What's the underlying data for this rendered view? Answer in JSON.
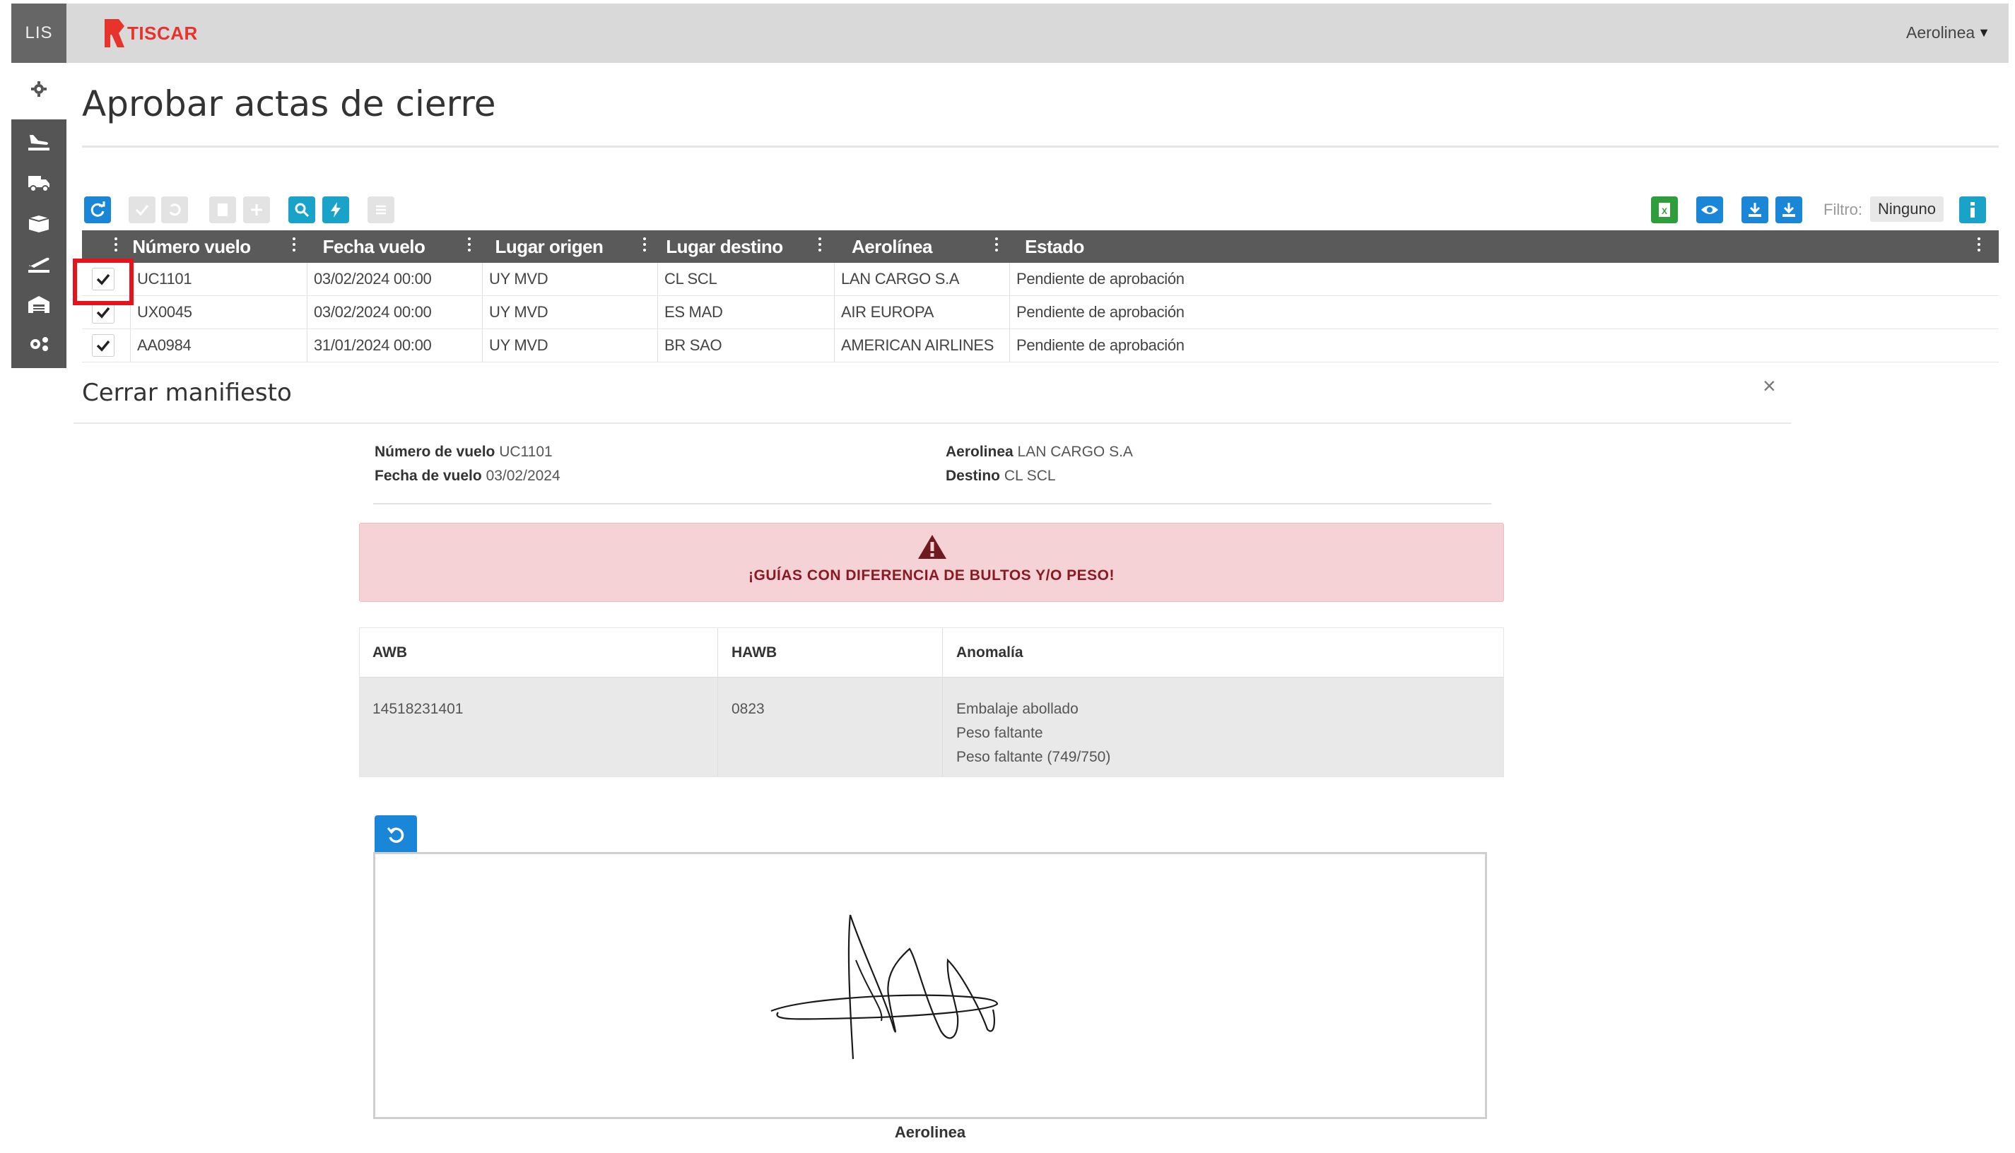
{
  "app": {
    "short_name": "LIS",
    "logo_text": "TISCAR",
    "user_menu": "Aerolinea",
    "brand_color": "#e8322c"
  },
  "sidebar": {
    "items": [
      {
        "icon": "gear-icon"
      },
      {
        "icon": "plane-landing-icon"
      },
      {
        "icon": "truck-icon"
      },
      {
        "icon": "box-icon"
      },
      {
        "icon": "plane-takeoff-icon"
      },
      {
        "icon": "warehouse-icon"
      },
      {
        "icon": "settings-icon"
      }
    ]
  },
  "page": {
    "title": "Aprobar actas de cierre"
  },
  "toolbar": {
    "filter_label": "Filtro:",
    "filter_value": "Ninguno"
  },
  "grid": {
    "columns": [
      "Número vuelo",
      "Fecha vuelo",
      "Lugar origen",
      "Lugar destino",
      "Aerolínea",
      "Estado"
    ],
    "rows": [
      {
        "checked": true,
        "numero": "UC1101",
        "fecha": "03/02/2024 00:00",
        "origen": "UY MVD",
        "destino": "CL SCL",
        "aerolinea": "LAN CARGO S.A",
        "estado": "Pendiente de aprobación"
      },
      {
        "checked": true,
        "numero": "UX0045",
        "fecha": "03/02/2024 00:00",
        "origen": "UY MVD",
        "destino": "ES MAD",
        "aerolinea": "AIR EUROPA",
        "estado": "Pendiente de aprobación"
      },
      {
        "checked": true,
        "numero": "AA0984",
        "fecha": "31/01/2024 00:00",
        "origen": "UY MVD",
        "destino": "BR SAO",
        "aerolinea": "AMERICAN AIRLINES",
        "estado": "Pendiente de aprobación"
      }
    ]
  },
  "modal": {
    "title": "Cerrar manifiesto",
    "close": "×",
    "info": {
      "numero_label": "Número de vuelo",
      "numero_value": "UC1101",
      "fecha_label": "Fecha de vuelo",
      "fecha_value": "03/02/2024",
      "aerolinea_label": "Aerolinea",
      "aerolinea_value": "LAN CARGO S.A",
      "destino_label": "Destino",
      "destino_value": "CL SCL"
    },
    "alert": {
      "text": "¡GUÍAS CON DIFERENCIA DE BULTOS Y/O PESO!",
      "color": "#8a1a22"
    },
    "anomalies": {
      "headers": [
        "AWB",
        "HAWB",
        "Anomalía"
      ],
      "rows": [
        {
          "awb": "14518231401",
          "hawb": "0823",
          "anomalias": [
            "Embalaje abollado",
            "Peso faltante",
            "Peso faltante (749/750)"
          ]
        }
      ]
    },
    "signature_label": "Aerolinea"
  }
}
